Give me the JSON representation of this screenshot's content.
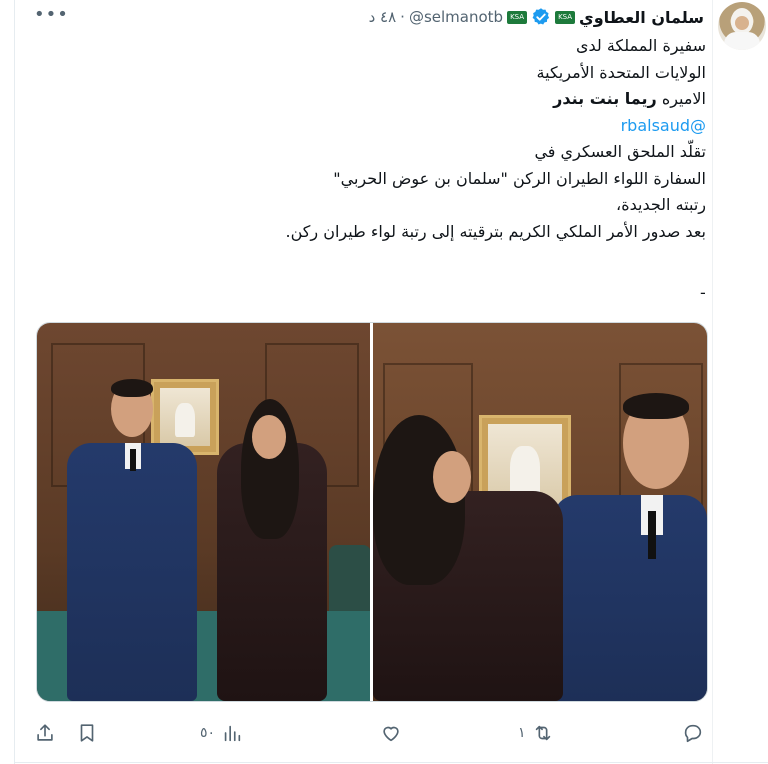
{
  "tweet": {
    "author_name": "سلمان العطاوي",
    "author_handle": "@selmanotb",
    "separator": "·",
    "time": "٤٨ د",
    "flag_label": "KSA",
    "lines": [
      {
        "text": "سفيرة المملكة لدى",
        "style": "normal"
      },
      {
        "text": "الولايات المتحدة الأمريكية",
        "style": "normal"
      },
      {
        "prefix": "الاميره ",
        "bold": "ريما بنت بندر"
      },
      {
        "text": "@rbalsaud",
        "style": "mention"
      },
      {
        "text": "تقلّد الملحق العسكري في",
        "style": "normal"
      },
      {
        "text": "السفارة اللواء الطيران الركن \"سلمان بن عوض الحربي\"",
        "style": "normal"
      },
      {
        "text": "رتبته الجديدة،",
        "style": "normal"
      },
      {
        "text": "بعد صدور الأمر الملكي الكريم بترقيته إلى رتبة لواء طيران ركن.",
        "style": "normal"
      }
    ],
    "trailing_dash": "-"
  },
  "actions": {
    "reply_count": "",
    "retweet_count": "١",
    "like_count": "",
    "views_count": "٥٠"
  },
  "icons": {
    "more": "more-icon",
    "verified": "verified-badge-icon",
    "reply": "reply-icon",
    "retweet": "retweet-icon",
    "like": "like-icon",
    "views": "views-icon",
    "bookmark": "bookmark-icon",
    "share": "share-icon"
  },
  "colors": {
    "verified": "#1d9bf0",
    "text": "#0f1419",
    "muted": "#536471",
    "mention": "#1d9bf0"
  }
}
